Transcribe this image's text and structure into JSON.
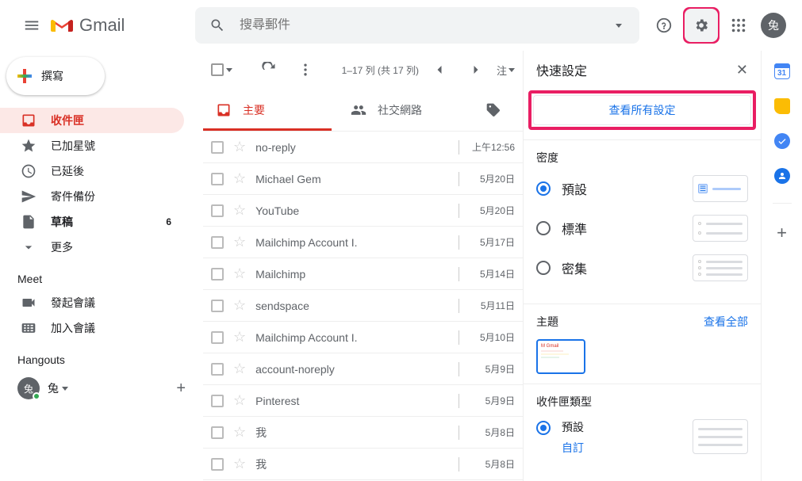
{
  "header": {
    "product_name": "Gmail",
    "search_placeholder": "搜尋郵件",
    "avatar_letter": "兔"
  },
  "sidebar": {
    "compose_label": "撰寫",
    "nav": [
      {
        "key": "inbox",
        "label": "收件匣",
        "count": ""
      },
      {
        "key": "starred",
        "label": "已加星號",
        "count": ""
      },
      {
        "key": "snoozed",
        "label": "已延後",
        "count": ""
      },
      {
        "key": "sent",
        "label": "寄件備份",
        "count": ""
      },
      {
        "key": "drafts",
        "label": "草稿",
        "count": "6"
      },
      {
        "key": "more",
        "label": "更多",
        "count": ""
      }
    ],
    "meet_title": "Meet",
    "meet_items": [
      {
        "key": "newmeeting",
        "label": "發起會議"
      },
      {
        "key": "joinmeeting",
        "label": "加入會議"
      }
    ],
    "hangouts_title": "Hangouts",
    "hangouts_user_letter": "兔",
    "hangouts_user_name": "兔"
  },
  "toolbar": {
    "range_text": "1–17 列 (共 17 列)",
    "lang_hint": "注"
  },
  "tabs": [
    {
      "key": "primary",
      "label": "主要"
    },
    {
      "key": "social",
      "label": "社交網路"
    }
  ],
  "messages": [
    {
      "sender": "no-reply",
      "date": "上午12:56"
    },
    {
      "sender": "Michael Gem",
      "date": "5月20日"
    },
    {
      "sender": "YouTube",
      "date": "5月20日"
    },
    {
      "sender": "Mailchimp Account I.",
      "date": "5月17日"
    },
    {
      "sender": "Mailchimp",
      "date": "5月14日"
    },
    {
      "sender": "sendspace",
      "date": "5月11日"
    },
    {
      "sender": "Mailchimp Account I.",
      "date": "5月10日"
    },
    {
      "sender": "account-noreply",
      "date": "5月9日"
    },
    {
      "sender": "Pinterest",
      "date": "5月9日"
    },
    {
      "sender": "我",
      "date": "5月8日"
    },
    {
      "sender": "我",
      "date": "5月8日"
    }
  ],
  "quickpanel": {
    "title": "快速設定",
    "all_settings": "查看所有設定",
    "density_title": "密度",
    "density_options": [
      {
        "key": "default",
        "label": "預設"
      },
      {
        "key": "standard",
        "label": "標準"
      },
      {
        "key": "compact",
        "label": "密集"
      }
    ],
    "theme_title": "主題",
    "theme_link": "查看全部",
    "inboxtype_title": "收件匣類型",
    "inboxtype_default": "預設",
    "inboxtype_custom": "自訂"
  },
  "sidepanel": {
    "calendar_day": "31"
  }
}
